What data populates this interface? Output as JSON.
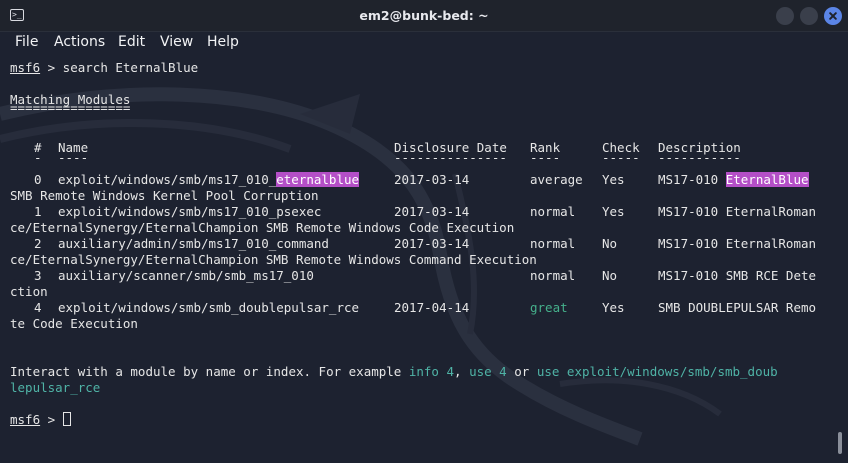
{
  "window": {
    "title": "em2@bunk-bed: ~",
    "terminal_icon": "terminal-icon"
  },
  "menu": [
    "File",
    "Actions",
    "Edit",
    "View",
    "Help"
  ],
  "prompt": {
    "name": "msf6",
    "command": " > search EternalBlue"
  },
  "heading": "Matching Modules",
  "heading_rule": "================",
  "columns": {
    "num": "#",
    "name": "Name",
    "date": "Disclosure Date",
    "rank": "Rank",
    "check": "Check",
    "desc": "Description"
  },
  "column_rules": {
    "num": "-",
    "name": "----",
    "date": "---------------",
    "rank": "----",
    "check": "-----",
    "desc": "-----------"
  },
  "modules": [
    {
      "num": "0",
      "name_prefix": "exploit/windows/smb/ms17_010_",
      "name_highlight": "eternalblue",
      "date": "2017-03-14",
      "rank": "average",
      "check": "Yes",
      "desc_prefix": "MS17-010 ",
      "desc_highlight": "EternalBlue",
      "wrap": "SMB Remote Windows Kernel Pool Corruption"
    },
    {
      "num": "1",
      "name": "exploit/windows/smb/ms17_010_psexec",
      "date": "2017-03-14",
      "rank": "normal",
      "check": "Yes",
      "desc": "MS17-010 EternalRoman",
      "wrap": "ce/EternalSynergy/EternalChampion SMB Remote Windows Code Execution"
    },
    {
      "num": "2",
      "name": "auxiliary/admin/smb/ms17_010_command",
      "date": "2017-03-14",
      "rank": "normal",
      "check": "No",
      "desc": "MS17-010 EternalRoman",
      "wrap": "ce/EternalSynergy/EternalChampion SMB Remote Windows Command Execution"
    },
    {
      "num": "3",
      "name": "auxiliary/scanner/smb/smb_ms17_010",
      "date": "",
      "rank": "normal",
      "check": "No",
      "desc": "MS17-010 SMB RCE Dete",
      "wrap": "ction"
    },
    {
      "num": "4",
      "name": "exploit/windows/smb/smb_doublepulsar_rce",
      "date": "2017-04-14",
      "rank": "great",
      "check": "Yes",
      "desc": "SMB DOUBLEPULSAR Remo",
      "wrap": "te Code Execution"
    }
  ],
  "interact": {
    "text1": "Interact with a module by name or index. For example ",
    "info": "info 4",
    "sep1": ", ",
    "use4": "use 4",
    "sep2": " or ",
    "use_path": "use exploit/windows/smb/smb_doub",
    "wrap": "lepulsar_rce"
  },
  "final_prompt": {
    "name": "msf6",
    "text": " > "
  },
  "colors": {
    "highlight": "#b44fc7",
    "teal": "#4fb3a6",
    "great": "#45b08b",
    "close_button": "#5b85e6"
  }
}
